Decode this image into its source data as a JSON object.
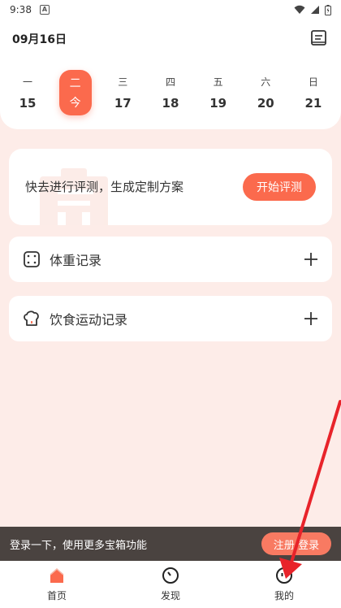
{
  "status": {
    "time": "9:38",
    "notif": "A"
  },
  "header": {
    "date": "09月16日",
    "book_icon": "book-icon"
  },
  "week": [
    {
      "weekday": "一",
      "num": "15",
      "active": false
    },
    {
      "weekday": "二",
      "num": "今",
      "active": true
    },
    {
      "weekday": "三",
      "num": "17",
      "active": false
    },
    {
      "weekday": "四",
      "num": "18",
      "active": false
    },
    {
      "weekday": "五",
      "num": "19",
      "active": false
    },
    {
      "weekday": "六",
      "num": "20",
      "active": false
    },
    {
      "weekday": "日",
      "num": "21",
      "active": false
    }
  ],
  "assessment": {
    "text": "快去进行评测，生成定制方案",
    "button": "开始评测"
  },
  "records": [
    {
      "label": "体重记录",
      "icon": "scale-icon"
    },
    {
      "label": "饮食运动记录",
      "icon": "chef-hat-icon"
    }
  ],
  "login_banner": {
    "text": "登录一下，使用更多宝箱功能",
    "button": "注册/登录"
  },
  "nav": [
    {
      "label": "首页",
      "icon": "home-icon"
    },
    {
      "label": "发现",
      "icon": "compass-icon"
    },
    {
      "label": "我的",
      "icon": "profile-icon"
    }
  ],
  "colors": {
    "accent": "#fb6a4d",
    "background": "#fdece8",
    "banner": "#4a4340",
    "annotation": "#e8232a"
  }
}
